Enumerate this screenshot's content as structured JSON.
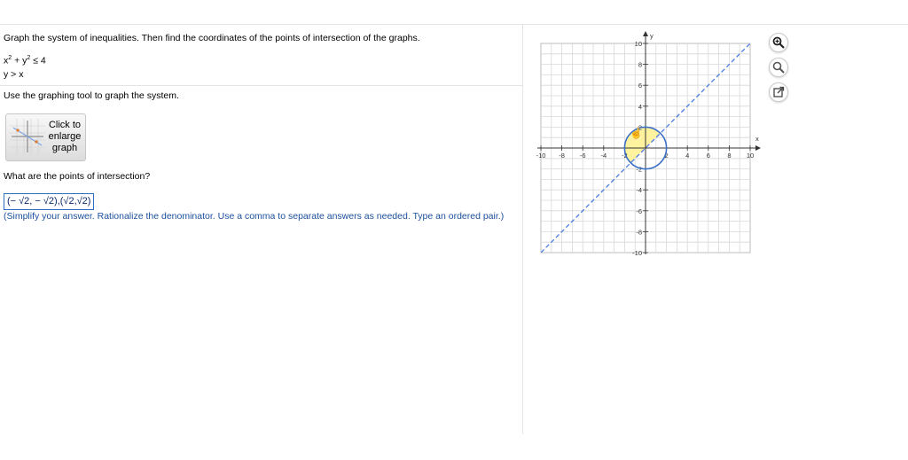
{
  "question": {
    "text": "Graph the system of inequalities. Then find the coordinates of the points of intersection of the graphs.",
    "ineq1_a": "x",
    "ineq1_b": " + y",
    "ineq1_c": " ≤ 4",
    "ineq1_exp": "2",
    "ineq2": "y > x"
  },
  "instruction": "Use the graphing tool to graph the system.",
  "enlarge_button": {
    "line1": "Click to",
    "line2": "enlarge",
    "line3": "graph"
  },
  "prompt": "What are the points of intersection?",
  "answer": "(− √2, − √2),(√2,√2)",
  "hint": "(Simplify your answer. Rationalize the denominator. Use a comma to separate answers as needed. Type an ordered pair.)",
  "graph": {
    "x_axis_label": "x",
    "y_axis_label": "y",
    "x_ticks": [
      "-10",
      "-8",
      "-6",
      "-4",
      "-2",
      "2",
      "4",
      "6",
      "8",
      "10"
    ],
    "y_ticks": [
      "10",
      "8",
      "6",
      "4",
      "2",
      "-2",
      "-4",
      "-6",
      "-8",
      "-10"
    ],
    "xlim": [
      -10,
      10
    ],
    "ylim": [
      -10,
      10
    ],
    "grid": true,
    "circle_radius": 2,
    "line_slope": 1,
    "line_style": "dashed",
    "circle_color": "#3c6fc8",
    "line_color": "#4a7de0",
    "shade_color": "#fff3a0"
  },
  "tools": {
    "zoom_in": "zoom-in-icon",
    "zoom_out": "zoom-out-icon",
    "popout": "popout-icon"
  }
}
